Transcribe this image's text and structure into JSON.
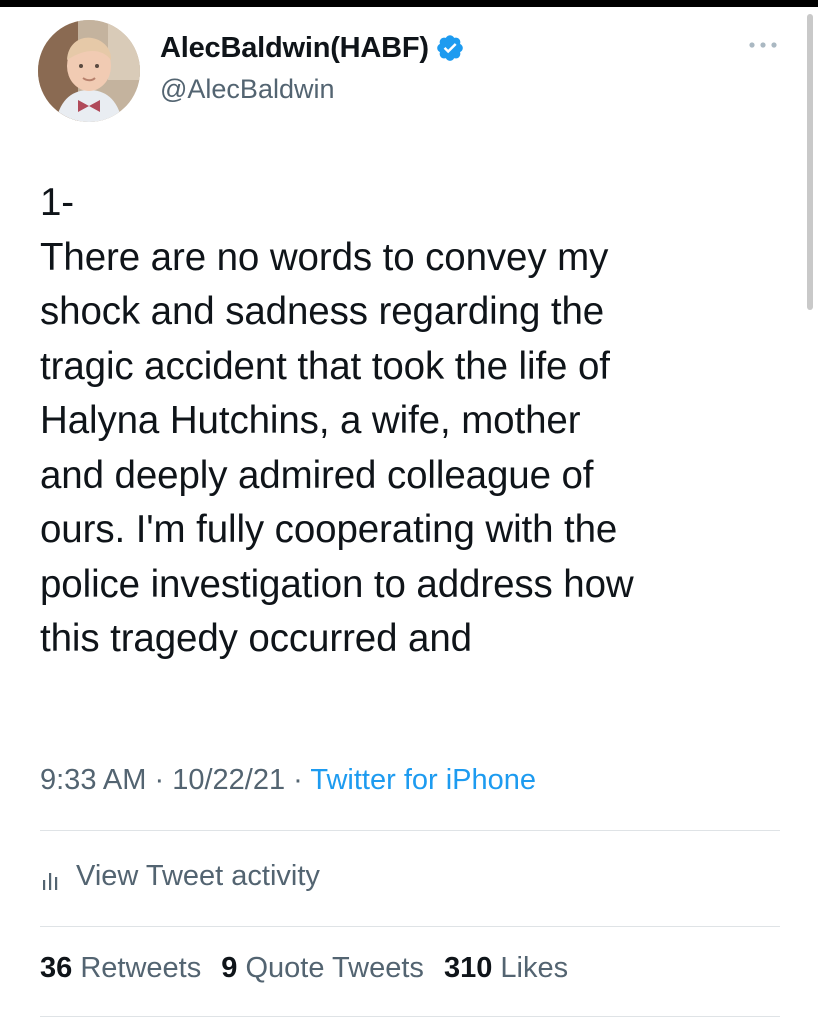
{
  "tweet": {
    "author": {
      "display_name": "AlecBaldwin(HABF)",
      "handle": "@AlecBaldwin",
      "verified": true,
      "avatar_icon": "profile-photo"
    },
    "more_icon": "more-horizontal-icon",
    "text": "1-\nThere are no words to convey my\nshock and sadness regarding the\ntragic accident that took the life of\nHalyna Hutchins, a wife, mother\nand deeply admired colleague of\nours. I'm fully cooperating with the\npolice investigation to address how\nthis tragedy occurred and",
    "meta": {
      "time": "9:33 AM",
      "separator": "·",
      "date": "10/22/21",
      "source": "Twitter for iPhone"
    },
    "activity": {
      "icon": "bar-chart-icon",
      "label": "View Tweet activity"
    },
    "stats": {
      "retweets": {
        "count": "36",
        "label": "Retweets"
      },
      "quote_tweets": {
        "count": "9",
        "label": "Quote Tweets"
      },
      "likes": {
        "count": "310",
        "label": "Likes"
      }
    }
  },
  "colors": {
    "text_primary": "#0f1419",
    "text_secondary": "#536471",
    "accent_blue": "#1d9bf0",
    "divider": "#dfe3e6",
    "background": "#ffffff"
  }
}
